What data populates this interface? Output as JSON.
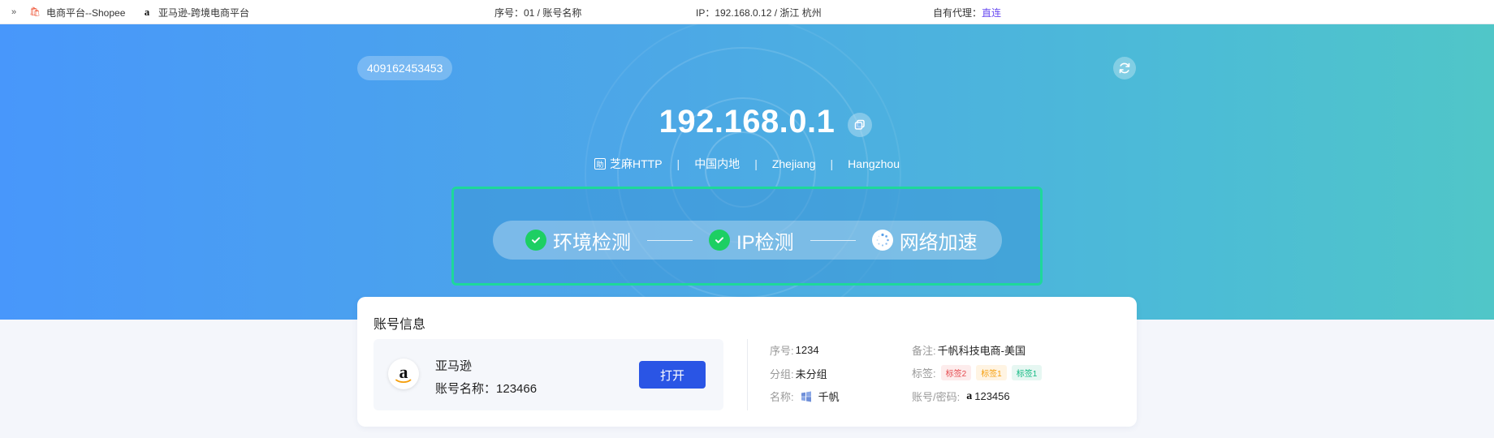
{
  "topbar": {
    "more_glyph": "»",
    "tabs": [
      {
        "label": "电商平台--Shopee",
        "icon": "shopee-bag-icon",
        "glyph": "🛍"
      },
      {
        "label": "亚马逊-跨境电商平台",
        "icon": "amazon-icon",
        "glyph": "a"
      }
    ],
    "serial_text": "序号：01 / 账号名称",
    "ip_text": "IP：192.168.0.12 / 浙江 杭州",
    "proxy_label": "自有代理：",
    "proxy_link": "直连",
    "link_color": "#6a4cf0"
  },
  "hero": {
    "account_id": "409162453453",
    "ip": "192.168.0.1",
    "provider": "芝麻HTTP",
    "provider_icon_glyph": "助",
    "region": "中国内地",
    "province": "Zhejiang",
    "city": "Hangzhou",
    "separator": "|",
    "steps": [
      {
        "label": "环境检测",
        "status": "done"
      },
      {
        "label": "IP检测",
        "status": "done"
      },
      {
        "label": "网络加速",
        "status": "loading"
      }
    ]
  },
  "card": {
    "title": "账号信息",
    "platform_name": "亚马逊",
    "platform_glyph": "a",
    "account_label": "账号名称：",
    "account_name": "123466",
    "open_label": "打开",
    "serial_label": "序号:",
    "serial": "1234",
    "group_label": "分组:",
    "group": "未分组",
    "name_label": "名称:",
    "name": "千帆",
    "note_label": "备注:",
    "note": "千帆科技电商-美国",
    "tags_label": "标签:",
    "tags": [
      "标签2",
      "标签1",
      "标签1"
    ],
    "password_label": "账号/密码:",
    "password": "123456",
    "accent_color": "#2a55e5"
  }
}
